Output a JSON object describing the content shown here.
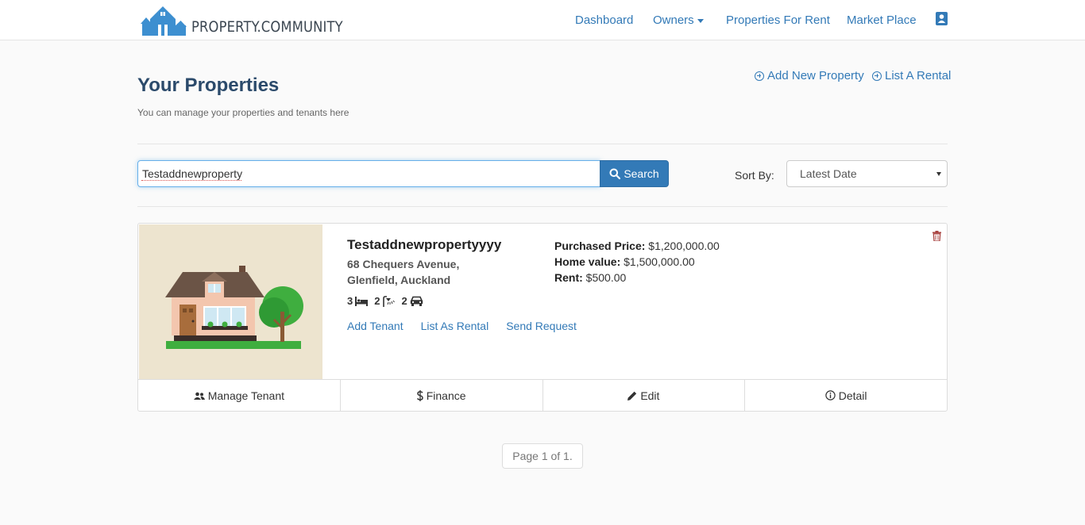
{
  "brand": {
    "name": "PROPERTY.COMMUNITY"
  },
  "nav": {
    "dashboard": "Dashboard",
    "owners": "Owners",
    "properties_for_rent": "Properties For Rent",
    "market_place": "Market Place",
    "profile_icon": "user-card-icon"
  },
  "page": {
    "title": "Your Properties",
    "subtitle": "You can manage your properties and tenants here",
    "add_new_property": "Add New Property",
    "list_a_rental": "List A Rental"
  },
  "search": {
    "value": "Testaddnewproperty",
    "button_label": "Search"
  },
  "sort": {
    "label": "Sort By:",
    "selected": "Latest Date"
  },
  "property": {
    "name": "Testaddnewpropertyyyy",
    "address_line1": "68 Chequers Avenue,",
    "address_line2": "Glenfield, Auckland",
    "bedrooms": "3",
    "bathrooms": "2",
    "parking": "2",
    "purchased_price_label": "Purchased Price:",
    "purchased_price": "$1,200,000.00",
    "home_value_label": "Home value:",
    "home_value": "$1,500,000.00",
    "rent_label": "Rent:",
    "rent": "$500.00",
    "links": {
      "add_tenant": "Add Tenant",
      "list_as_rental": "List As Rental",
      "send_request": "Send Request"
    },
    "footer": {
      "manage_tenant": "Manage Tenant",
      "finance": "Finance",
      "edit": "Edit",
      "detail": "Detail"
    }
  },
  "pagination": {
    "text": "Page 1 of 1."
  },
  "colors": {
    "primary": "#337ab7",
    "title": "#2b4a6b",
    "delete": "#a94442"
  }
}
